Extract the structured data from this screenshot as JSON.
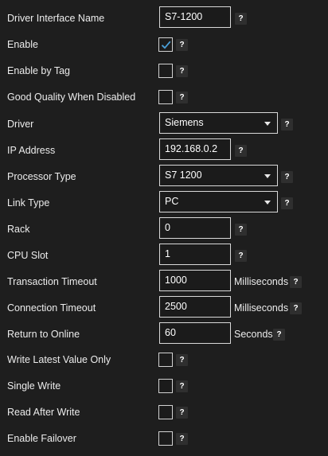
{
  "help_glyph": "?",
  "colors": {
    "background": "#1e1e1e",
    "check_mark": "#4a9fd8",
    "field_border": "#d9d9d9"
  },
  "rows": [
    {
      "label": "Driver Interface Name",
      "control": "text",
      "value": "S7-1200"
    },
    {
      "label": "Enable",
      "control": "checkbox",
      "checked": true
    },
    {
      "label": "Enable by Tag",
      "control": "checkbox",
      "checked": false
    },
    {
      "label": "Good Quality When Disabled",
      "control": "checkbox",
      "checked": false
    },
    {
      "label": "Driver",
      "control": "select",
      "value": "Siemens"
    },
    {
      "label": "IP Address",
      "control": "text",
      "value": "192.168.0.2"
    },
    {
      "label": "Processor Type",
      "control": "select",
      "value": "S7 1200"
    },
    {
      "label": "Link Type",
      "control": "select",
      "value": "PC"
    },
    {
      "label": "Rack",
      "control": "text",
      "value": "0"
    },
    {
      "label": "CPU Slot",
      "control": "text",
      "value": "1"
    },
    {
      "label": "Transaction Timeout",
      "control": "text",
      "value": "1000",
      "unit": "Milliseconds"
    },
    {
      "label": "Connection Timeout",
      "control": "text",
      "value": "2500",
      "unit": "Milliseconds"
    },
    {
      "label": "Return to Online",
      "control": "text",
      "value": "60",
      "unit": "Seconds"
    },
    {
      "label": "Write Latest Value Only",
      "control": "checkbox",
      "checked": false
    },
    {
      "label": "Single Write",
      "control": "checkbox",
      "checked": false
    },
    {
      "label": "Read After Write",
      "control": "checkbox",
      "checked": false
    },
    {
      "label": "Enable Failover",
      "control": "checkbox",
      "checked": false
    }
  ]
}
